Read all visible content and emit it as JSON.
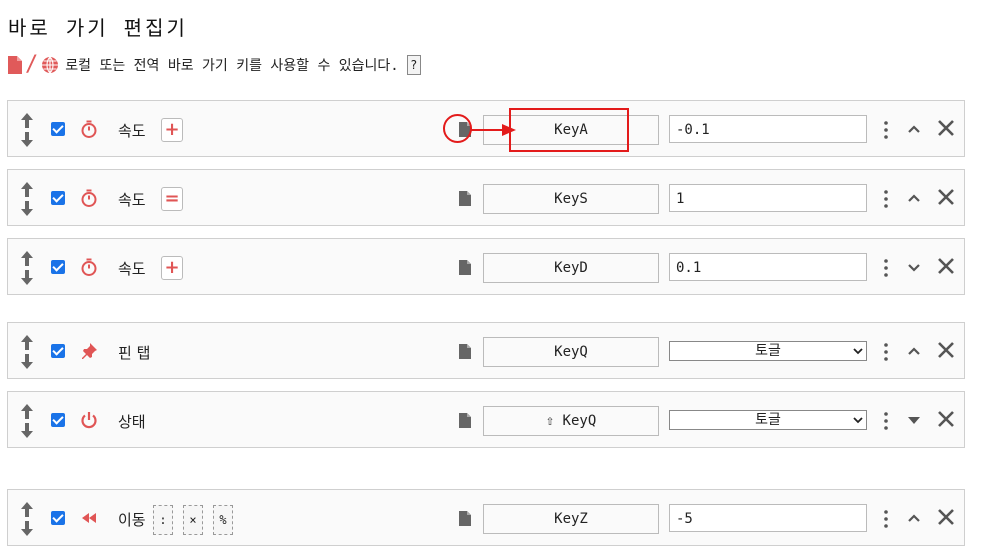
{
  "header": {
    "title": "바로 가기 편집기",
    "subtitle": "로컬 또는 전역 바로 가기 키를 사용할 수 있습니다.",
    "help_label": "?",
    "slash": "/"
  },
  "colors": {
    "accent": "#e05555",
    "checkbox": "#1a73e8",
    "annotation": "#e31b1b"
  },
  "rows": [
    {
      "icon": "stopwatch-icon",
      "label": "속도",
      "op": "+",
      "key": "KeyA",
      "value": "-0.1",
      "chevron": "up"
    },
    {
      "icon": "stopwatch-icon",
      "label": "속도",
      "op": "=",
      "key": "KeyS",
      "value": "1",
      "chevron": "up"
    },
    {
      "icon": "stopwatch-icon",
      "label": "속도",
      "op": "+",
      "key": "KeyD",
      "value": "0.1",
      "chevron": "down"
    },
    {
      "icon": "pin-icon",
      "label": "핀 탭",
      "key": "KeyQ",
      "select": "토글",
      "chevron": "up"
    },
    {
      "icon": "power-icon",
      "label": "상태",
      "key": "⇧ KeyQ",
      "select": "토글",
      "chevron": "down-filled"
    },
    {
      "icon": "rewind-icon",
      "label": "이동",
      "extras": [
        ":",
        "×",
        "%"
      ],
      "key": "KeyZ",
      "value": "-5",
      "chevron": "up"
    }
  ]
}
